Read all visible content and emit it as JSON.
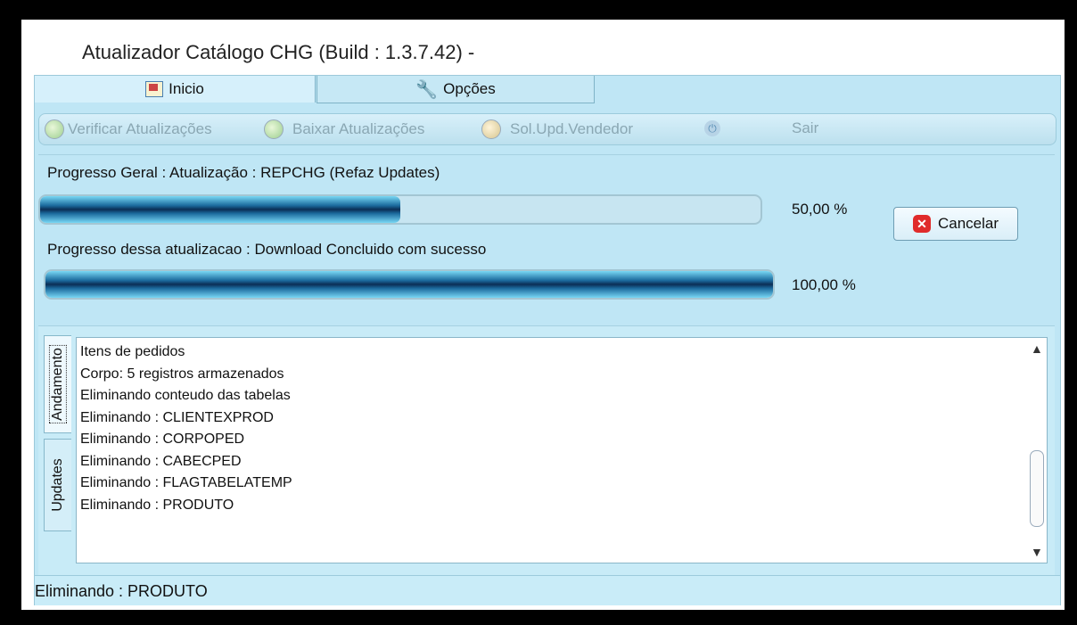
{
  "window": {
    "title": "Atualizador Catálogo CHG  (Build : 1.3.7.42) - "
  },
  "tabs": [
    {
      "label": "Inicio",
      "icon": "home-icon"
    },
    {
      "label": "Opções",
      "icon": "wrench-icon"
    }
  ],
  "toolbar": {
    "items": [
      {
        "label": "Verificar Atualizações",
        "icon": "check-update-icon"
      },
      {
        "label": "Baixar Atualizações",
        "icon": "download-update-icon"
      },
      {
        "label": "Sol.Upd.Vendedor",
        "icon": "vendor-update-icon"
      },
      {
        "label": "Sair",
        "icon": "power-icon"
      }
    ]
  },
  "progress": {
    "general_label": "Progresso Geral :  Atualização : REPCHG (Refaz Updates)",
    "general_value": 0.5,
    "general_pct_text": "50,00 %",
    "current_label": "Progresso dessa atualizacao :   Download Concluido com sucesso",
    "current_value": 1.0,
    "current_pct_text": "100,00 %",
    "cancel_label": "Cancelar",
    "cancel_icon": "cancel-x-icon"
  },
  "log": {
    "tabs": [
      "Andamento",
      "Updates"
    ],
    "lines": [
      "Itens de pedidos",
      "Corpo: 5 registros armazenados",
      "Eliminando conteudo das tabelas",
      "Eliminando : CLIENTEXPROD",
      "Eliminando : CORPOPED",
      "Eliminando : CABECPED",
      "Eliminando : FLAGTABELATEMP",
      "Eliminando : PRODUTO"
    ]
  },
  "status": {
    "text": "Eliminando : PRODUTO"
  },
  "colors": {
    "panel": "#bfe6f5",
    "progress_dark": "#0b2e55",
    "cancel_red": "#e02b2b"
  }
}
